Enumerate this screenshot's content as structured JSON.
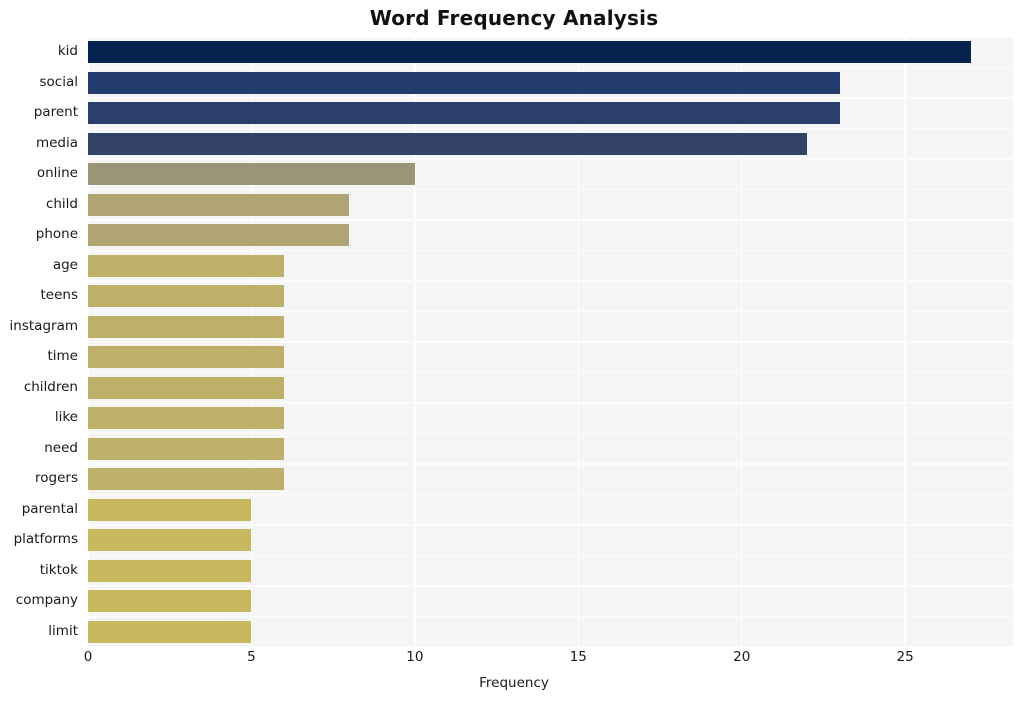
{
  "chart_data": {
    "type": "bar",
    "orientation": "horizontal",
    "title": "Word Frequency Analysis",
    "xlabel": "Frequency",
    "ylabel": "",
    "categories": [
      "kid",
      "social",
      "parent",
      "media",
      "online",
      "child",
      "phone",
      "age",
      "teens",
      "instagram",
      "time",
      "children",
      "like",
      "need",
      "rogers",
      "parental",
      "platforms",
      "tiktok",
      "company",
      "limit"
    ],
    "values": [
      27,
      23,
      23,
      22,
      10,
      8,
      8,
      6,
      6,
      6,
      6,
      6,
      6,
      6,
      6,
      5,
      5,
      5,
      5,
      5
    ],
    "bar_colors": [
      "#04244f",
      "#233b6c",
      "#2a3f6e",
      "#334268",
      "#9b9477",
      "#b0a573",
      "#b0a573",
      "#bfb069",
      "#bfb069",
      "#bfb069",
      "#bfb069",
      "#bfb069",
      "#bfb069",
      "#bfb069",
      "#bfb069",
      "#c8b95f",
      "#c8b95f",
      "#c8b95f",
      "#c8b95f",
      "#c8b95f"
    ],
    "xticks": [
      0,
      5,
      10,
      15,
      20,
      25
    ],
    "xtick_labels": [
      "0",
      "5",
      "10",
      "15",
      "20",
      "25"
    ],
    "xlim": [
      0,
      28.3
    ],
    "grid": true,
    "grid_color": "#ffffff",
    "plot_background": "#f5f5f5",
    "figure_background": "#ffffff",
    "title_color": "#111111",
    "tick_label_color": "#1a1a1a"
  }
}
